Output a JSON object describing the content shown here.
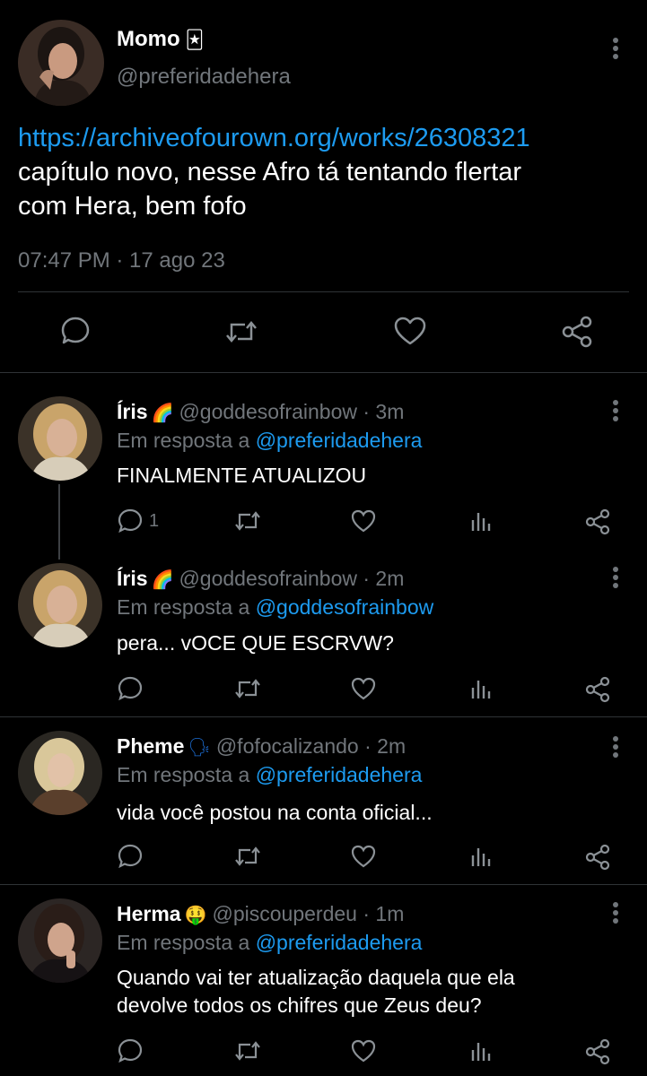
{
  "main_tweet": {
    "name": "Momo",
    "name_emoji": "🃏",
    "handle": "@preferidadehera",
    "link": "https://archiveofourown.org/works/26308321",
    "text_line1": "capítulo novo, nesse Afro tá tentando flertar",
    "text_line2": "com Hera, bem fofo",
    "timestamp": "07:47 PM · 17 ago 23"
  },
  "replies": [
    {
      "name": "Íris",
      "emoji": "🌈",
      "handle": "@goddesofrainbow",
      "time": "· 3m",
      "in_reply_label": "Em resposta a",
      "in_reply_handle": "@preferidadehera",
      "text": "FINALMENTE ATUALIZOU",
      "reply_count": "1"
    },
    {
      "name": "Íris",
      "emoji": "🌈",
      "handle": "@goddesofrainbow",
      "time": "· 2m",
      "in_reply_label": "Em resposta a",
      "in_reply_handle": "@goddesofrainbow",
      "text": "pera... vOCE QUE ESCRVW?",
      "reply_count": ""
    },
    {
      "name": "Pheme",
      "emoji": "🗣",
      "handle": "@fofocalizando",
      "time": "· 2m",
      "in_reply_label": "Em resposta a",
      "in_reply_handle": "@preferidadehera",
      "text": "vida você postou na conta oficial...",
      "reply_count": ""
    },
    {
      "name": "Herma",
      "emoji": "🤑",
      "handle": "@piscouperdeu",
      "time": "· 1m",
      "in_reply_label": "Em resposta a",
      "in_reply_handle": "@preferidadehera",
      "text_line1": "Quando vai ter atualização daquela que ela",
      "text_line2": "devolve todos os chifres que Zeus deu?",
      "reply_count": ""
    }
  ],
  "colors": {
    "background": "#000000",
    "text": "#e7e9ea",
    "muted": "#71767b",
    "link": "#1d9bf0",
    "divider": "#2f3336"
  },
  "icons": [
    "avatar",
    "more-vertical-icon",
    "reply-icon",
    "retweet-icon",
    "like-icon",
    "views-icon",
    "share-icon"
  ]
}
